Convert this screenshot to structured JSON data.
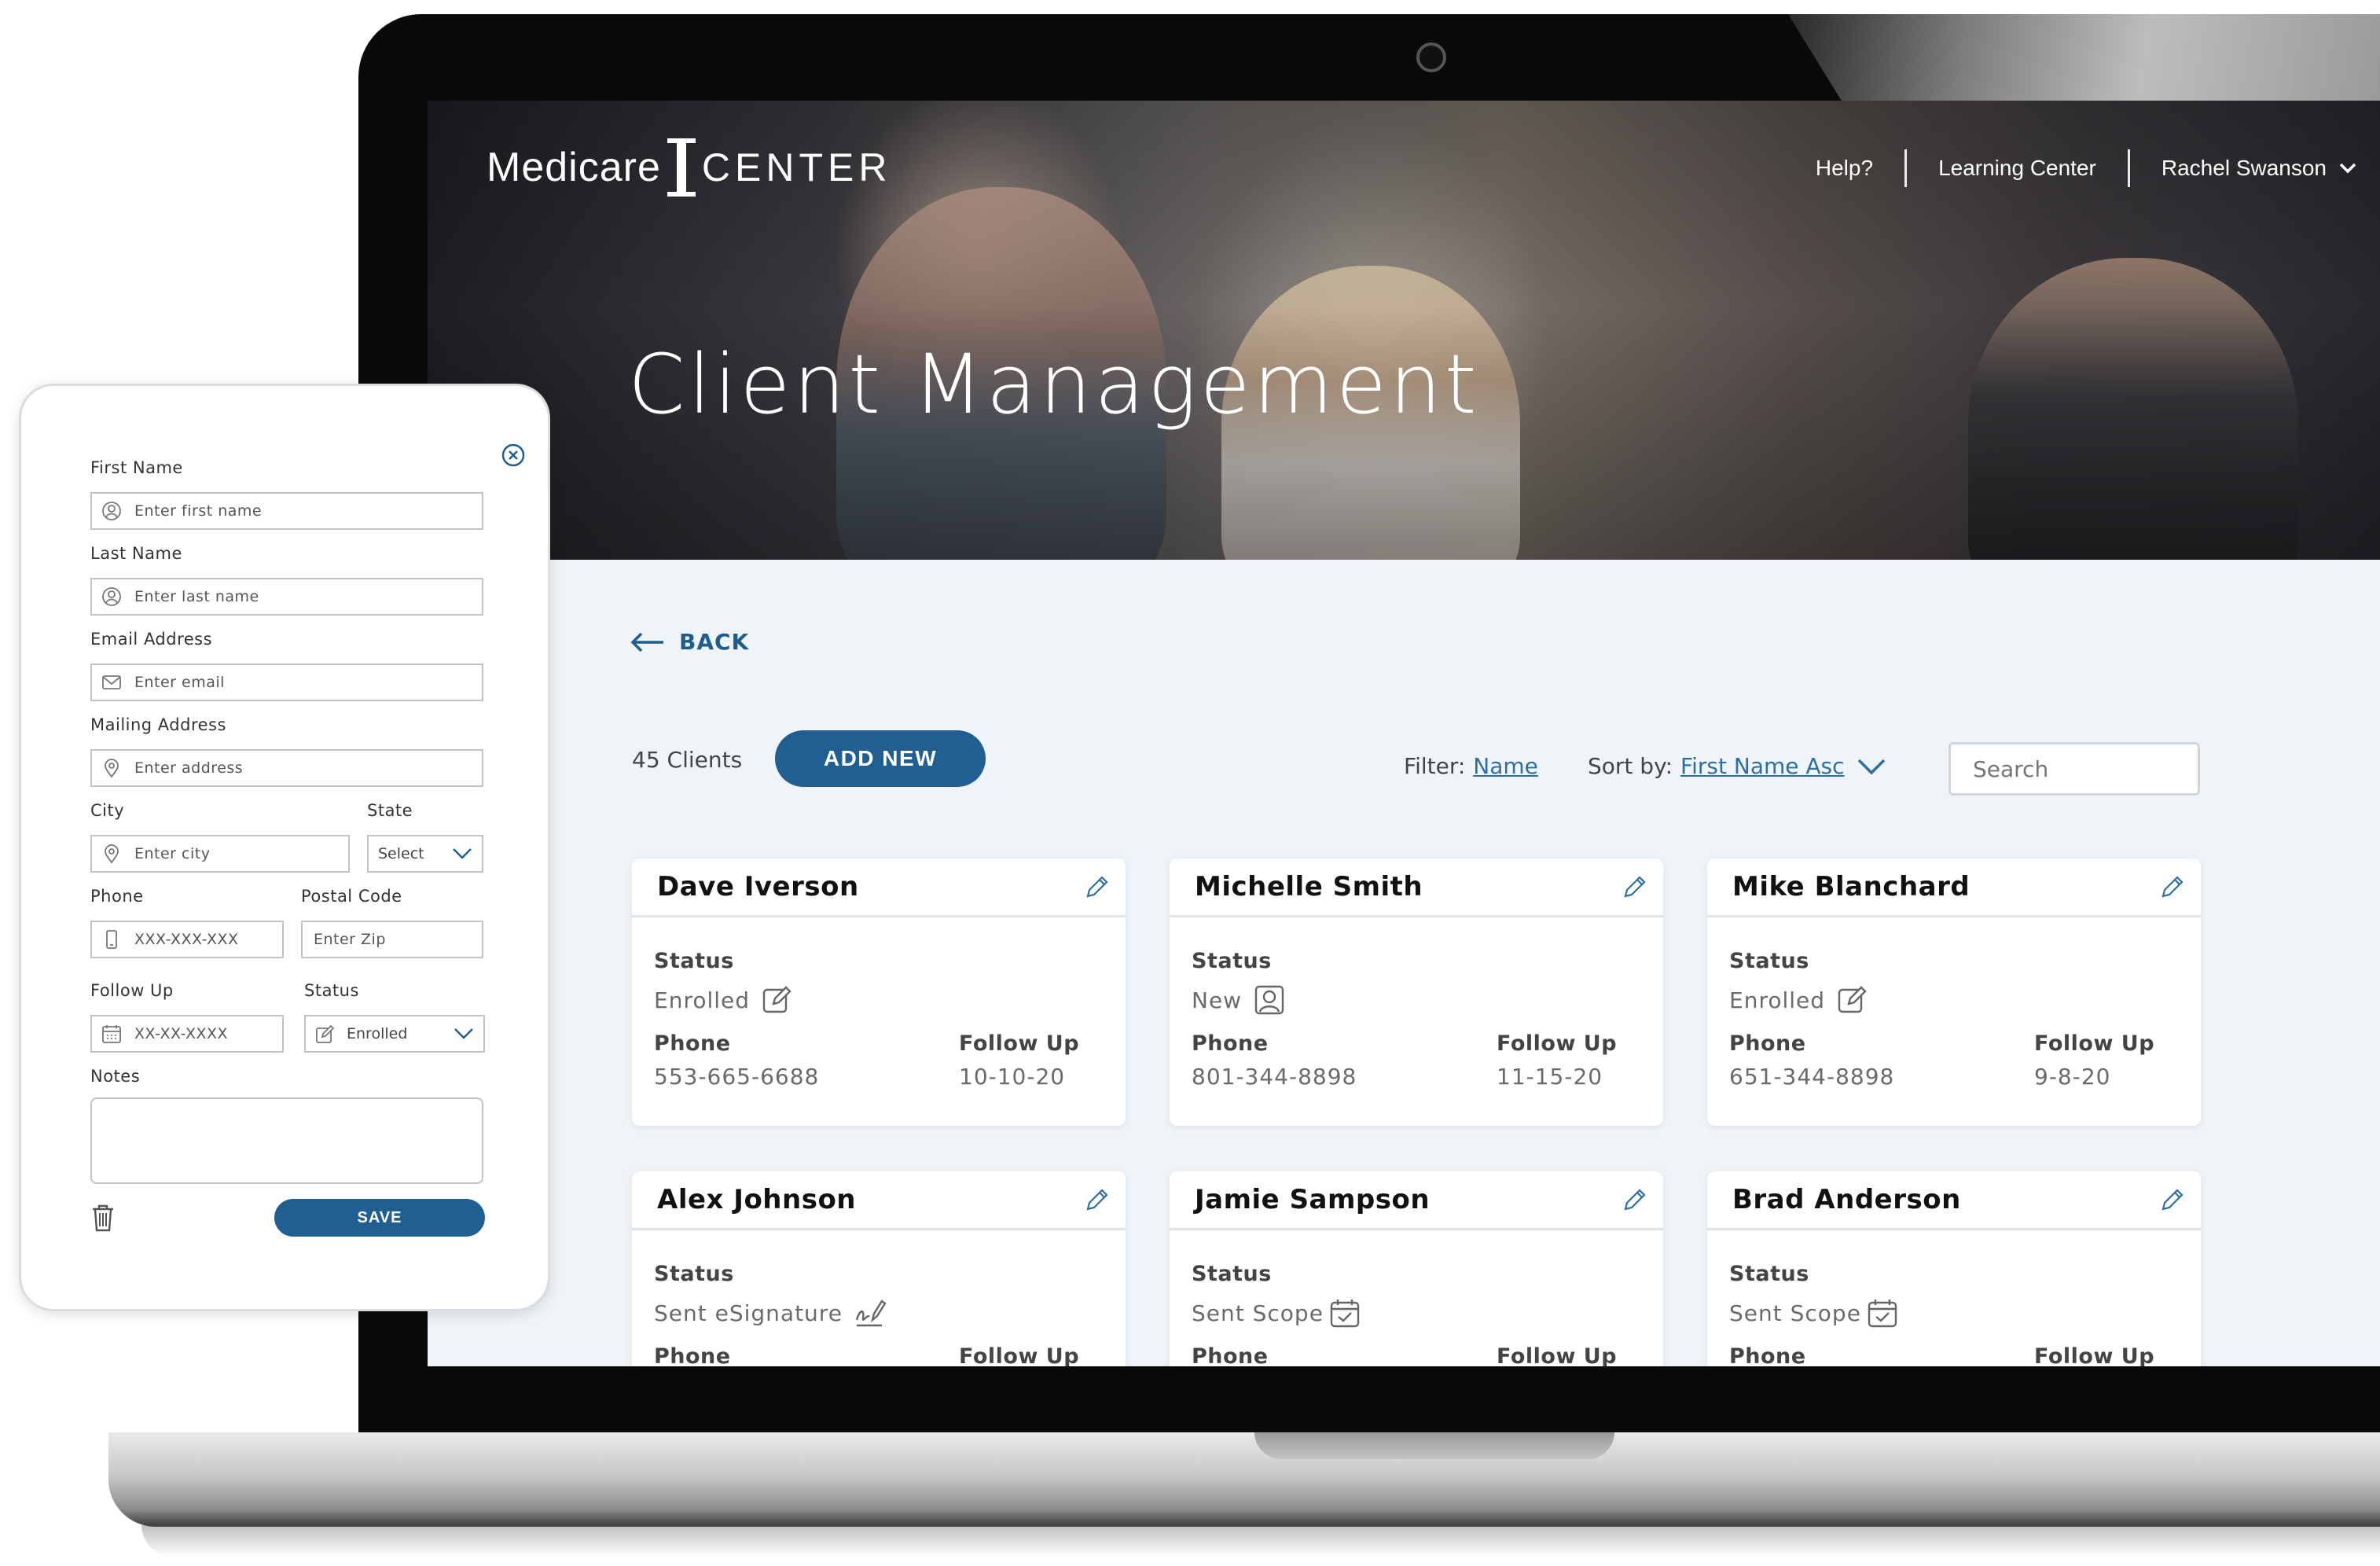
{
  "header": {
    "logo_primary": "Medicare",
    "logo_secondary": "CENTER",
    "nav": {
      "help": "Help?",
      "learning_center": "Learning Center",
      "user_name": "Rachel Swanson"
    },
    "page_title": "Client Management"
  },
  "toolbar": {
    "back_label": "BACK",
    "client_count": "45 Clients",
    "add_new_label": "ADD NEW",
    "filter_label": "Filter:",
    "filter_value": "Name",
    "sort_label": "Sort by:",
    "sort_value": "First Name Asc",
    "search_placeholder": "Search"
  },
  "card_labels": {
    "status": "Status",
    "phone": "Phone",
    "follow_up": "Follow Up"
  },
  "clients": [
    {
      "name": "Dave Iverson",
      "status": "Enrolled",
      "status_icon": "edit-square-icon",
      "phone": "553-665-6688",
      "follow_up": "10-10-20"
    },
    {
      "name": "Michelle Smith",
      "status": "New",
      "status_icon": "user-badge-icon",
      "phone": "801-344-8898",
      "follow_up": "11-15-20"
    },
    {
      "name": "Mike Blanchard",
      "status": "Enrolled",
      "status_icon": "edit-square-icon",
      "phone": "651-344-8898",
      "follow_up": "9-8-20"
    },
    {
      "name": "Alex Johnson",
      "status": "Sent eSignature",
      "status_icon": "signature-icon"
    },
    {
      "name": "Jamie Sampson",
      "status": "Sent Scope",
      "status_icon": "calendar-check-icon"
    },
    {
      "name": "Brad Anderson",
      "status": "Sent Scope",
      "status_icon": "calendar-check-icon"
    }
  ],
  "form": {
    "first_name": {
      "label": "First Name",
      "placeholder": "Enter first name"
    },
    "last_name": {
      "label": "Last Name",
      "placeholder": "Enter last name"
    },
    "email": {
      "label": "Email Address",
      "placeholder": "Enter email"
    },
    "address": {
      "label": "Mailing Address",
      "placeholder": "Enter address"
    },
    "city": {
      "label": "City",
      "placeholder": "Enter city"
    },
    "state": {
      "label": "State",
      "value": "Select"
    },
    "phone": {
      "label": "Phone",
      "placeholder": "XXX-XXX-XXX"
    },
    "postal": {
      "label": "Postal Code",
      "placeholder": "Enter Zip"
    },
    "follow_up": {
      "label": "Follow Up",
      "placeholder": "XX-XX-XXXX"
    },
    "status": {
      "label": "Status",
      "value": "Enrolled"
    },
    "notes": {
      "label": "Notes",
      "value": ""
    },
    "save_label": "SAVE"
  },
  "colors": {
    "accent": "#215f93",
    "link": "#2d6ea3",
    "page_bg": "#eef4f8"
  }
}
